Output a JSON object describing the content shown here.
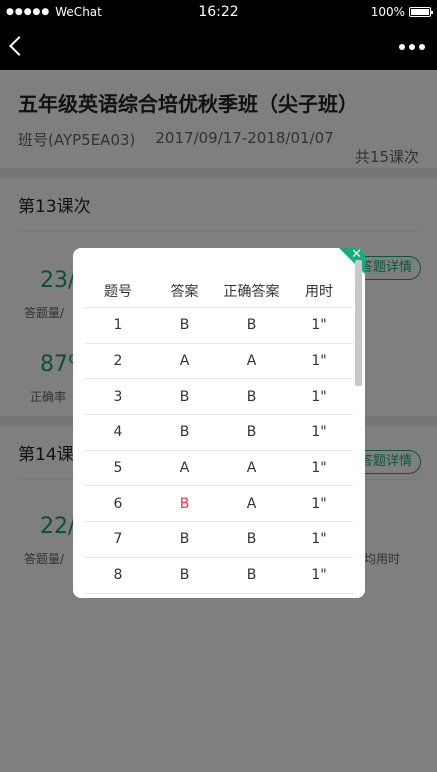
{
  "statusbar": {
    "carrier_dots": "●●●●●",
    "carrier": "WeChat",
    "time": "16:22",
    "battery": "100%"
  },
  "course": {
    "title": "五年级英语综合培优秋季班（尖子班）",
    "code": "班号(AYP5EA03)",
    "dates": "2017/09/17-2018/01/07",
    "total": "共15课次"
  },
  "lessons": [
    {
      "title": "第13课次",
      "detail_label": "答题详情",
      "count_value": "23/",
      "count_label": "答题量/",
      "rate_value": "87%",
      "rate_label": "正确率"
    },
    {
      "title": "第14课",
      "detail_label": "答题详情",
      "count_value": "22/",
      "count_label": "答题量/",
      "time_label": "均用时"
    }
  ],
  "modal": {
    "headers": [
      "题号",
      "答案",
      "正确答案",
      "用时"
    ],
    "rows": [
      {
        "no": "1",
        "answer": "B",
        "correct": "B",
        "time": "1\"",
        "wrong": false
      },
      {
        "no": "2",
        "answer": "A",
        "correct": "A",
        "time": "1\"",
        "wrong": false
      },
      {
        "no": "3",
        "answer": "B",
        "correct": "B",
        "time": "1\"",
        "wrong": false
      },
      {
        "no": "4",
        "answer": "B",
        "correct": "B",
        "time": "1\"",
        "wrong": false
      },
      {
        "no": "5",
        "answer": "A",
        "correct": "A",
        "time": "1\"",
        "wrong": false
      },
      {
        "no": "6",
        "answer": "B",
        "correct": "A",
        "time": "1\"",
        "wrong": true
      },
      {
        "no": "7",
        "answer": "B",
        "correct": "B",
        "time": "1\"",
        "wrong": false
      },
      {
        "no": "8",
        "answer": "B",
        "correct": "B",
        "time": "1\"",
        "wrong": false
      }
    ],
    "close_glyph": "✕"
  },
  "colors": {
    "accent": "#1aaa7e",
    "wrong": "#f0324c"
  }
}
